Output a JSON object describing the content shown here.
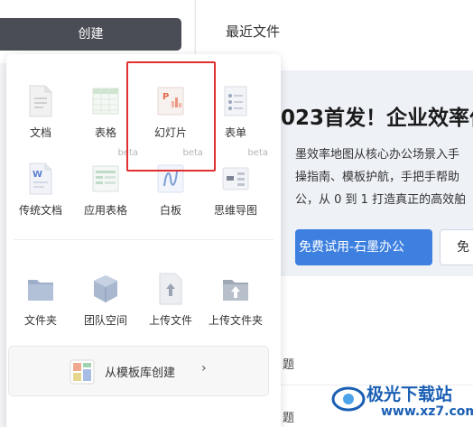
{
  "sidebar": {
    "create_label": "创建"
  },
  "header": {
    "recent_files": "最近文件"
  },
  "banner": {
    "title": "023首发！企业效率作",
    "line1": "墨效率地图从核心办公场景入手",
    "line2": "操指南、模板护航，手把手帮助",
    "line3": "公，从 0 到 1 打造真正的高效舶",
    "primary_button": "免费试用-石墨办公",
    "secondary_button": "免"
  },
  "recent_list": [
    {
      "text": "题"
    },
    {
      "text": "题"
    }
  ],
  "create_menu": {
    "row1": [
      {
        "label": "文档",
        "icon": "document-icon",
        "beta": ""
      },
      {
        "label": "表格",
        "icon": "spreadsheet-icon",
        "beta": "beta"
      },
      {
        "label": "幻灯片",
        "icon": "slides-icon",
        "beta": "beta"
      },
      {
        "label": "表单",
        "icon": "form-icon",
        "beta": "beta"
      }
    ],
    "row2": [
      {
        "label": "传统文档",
        "icon": "word-doc-icon",
        "beta": ""
      },
      {
        "label": "应用表格",
        "icon": "app-table-icon",
        "beta": ""
      },
      {
        "label": "白板",
        "icon": "whiteboard-icon",
        "beta": ""
      },
      {
        "label": "思维导图",
        "icon": "mindmap-icon",
        "beta": ""
      }
    ],
    "row3": [
      {
        "label": "文件夹",
        "icon": "folder-icon"
      },
      {
        "label": "团队空间",
        "icon": "team-space-icon"
      },
      {
        "label": "上传文件",
        "icon": "upload-file-icon"
      },
      {
        "label": "上传文件夹",
        "icon": "upload-folder-icon"
      }
    ],
    "template": {
      "label": "从模板库创建",
      "arrow": "›"
    }
  },
  "watermark": {
    "text": "极光下载站",
    "sub": "www.xz7.com"
  },
  "colors": {
    "create_button": "#4a4d55",
    "primary_blue": "#3d80e0",
    "highlight_red": "#e0302f",
    "banner_bg": "#eef1f6"
  }
}
